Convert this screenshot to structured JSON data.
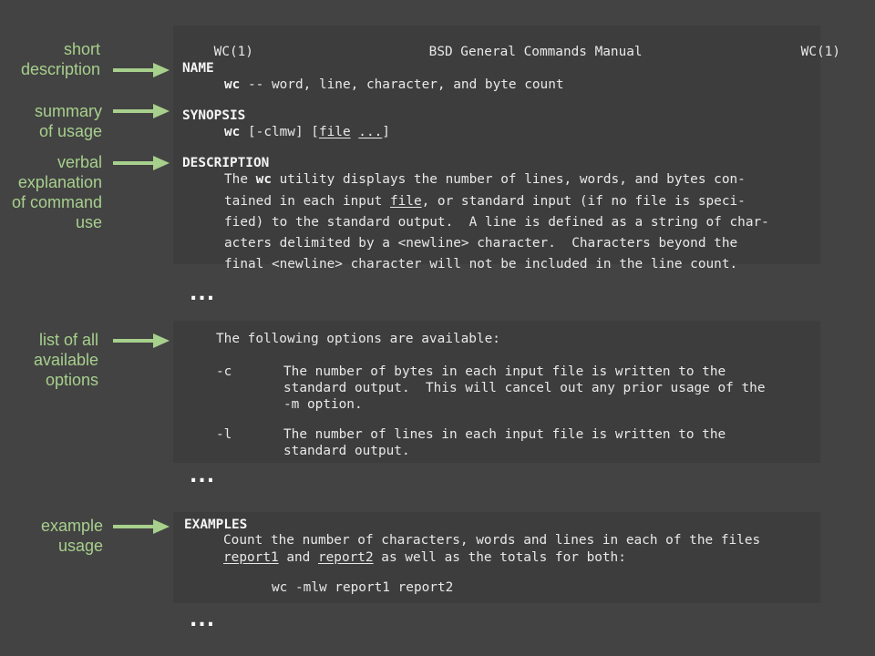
{
  "header": {
    "left": "WC(1)",
    "center": "BSD General Commands Manual",
    "right": "WC(1)"
  },
  "name_section": {
    "heading": "NAME",
    "cmd": "wc",
    "text": " -- word, line, character, and byte count"
  },
  "synopsis_section": {
    "heading": "SYNOPSIS",
    "cmd": "wc",
    "flags": " [-clmw] [",
    "arg_file": "file",
    "space": " ",
    "arg_more": "...",
    "close": "]"
  },
  "description_section": {
    "heading": "DESCRIPTION",
    "line1_pre": "The ",
    "line1_cmd": "wc",
    "line1_post": " utility displays the number of lines, words, and bytes con-",
    "line2_pre": "tained in each input ",
    "line2_file": "file",
    "line2_post": ", or standard input (if no file is speci-",
    "line3": "fied) to the standard output.  A line is defined as a string of char-",
    "line4": "acters delimited by a <newline> character.  Characters beyond the",
    "line5": "final <newline> character will not be included in the line count."
  },
  "options_section": {
    "intro": "The following options are available:",
    "opt_c_flag": "-c",
    "opt_c_line1": "The number of bytes in each input file is written to the",
    "opt_c_line2": "standard output.  This will cancel out any prior usage of the",
    "opt_c_line3": "-m option.",
    "opt_l_flag": "-l",
    "opt_l_line1": "The number of lines in each input file is written to the",
    "opt_l_line2": "standard output."
  },
  "examples_section": {
    "heading": "EXAMPLES",
    "line1": "Count the number of characters, words and lines in each of the files",
    "line2_report1": "report1",
    "line2_and": " and ",
    "line2_report2": "report2",
    "line2_post": " as well as the totals for both:",
    "command": "wc -mlw report1 report2"
  },
  "ellipsis": "...",
  "annotations": {
    "short_description": [
      "short",
      "description"
    ],
    "summary_of_usage": [
      "summary",
      "of usage"
    ],
    "verbal_explanation": [
      "verbal",
      "explanation",
      "of command",
      "use"
    ],
    "list_of_options": [
      "list of all",
      "available",
      "options"
    ],
    "example_usage": [
      "example",
      "usage"
    ]
  },
  "colors": {
    "background": "#434343",
    "terminal_background": "#3d3d3d",
    "annotation_green": "#a7d08c",
    "terminal_text": "#e8e8e8"
  }
}
